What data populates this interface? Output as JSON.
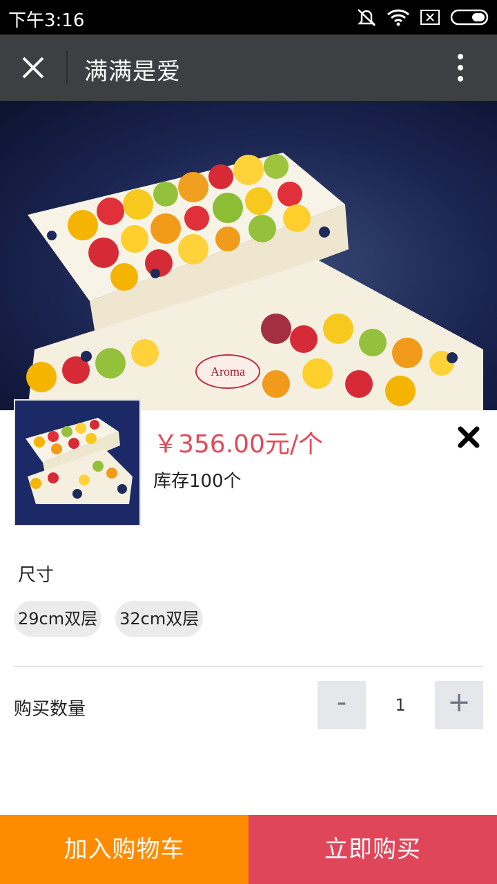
{
  "status_bar": {
    "time": "下午3:16"
  },
  "header": {
    "title": "满满是爱"
  },
  "product": {
    "price": "￥356.00元/个",
    "stock": "库存100个",
    "brand_text": "Aroma"
  },
  "options": {
    "size_label": "尺寸",
    "sizes": [
      "29cm双层",
      "32cm双层"
    ]
  },
  "quantity": {
    "label": "购买数量",
    "minus": "-",
    "value": "1",
    "plus": "+"
  },
  "actions": {
    "add_to_cart": "加入购物车",
    "buy_now": "立即购买"
  },
  "colors": {
    "price": "#e04a5a",
    "cart": "#ff8c00",
    "buy": "#e0465a",
    "title_bar": "#3d3f42"
  }
}
